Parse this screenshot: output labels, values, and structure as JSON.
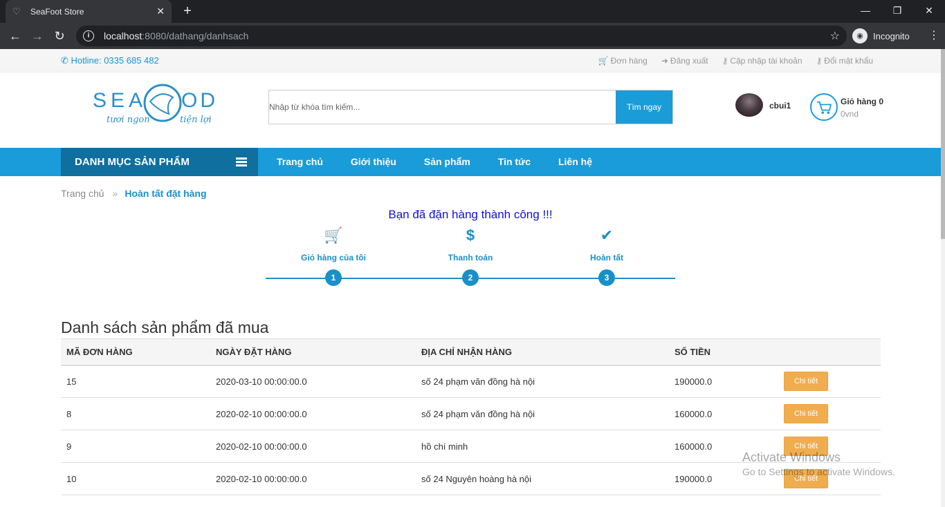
{
  "browser": {
    "tab_title": "SeaFoot Store",
    "tab_close": "✕",
    "new_tab": "+",
    "window_controls": {
      "minimize": "—",
      "restore": "❐",
      "close": "✕"
    },
    "url_host": "localhost",
    "url_rest": ":8080/dathang/danhsach",
    "incognito_label": "Incognito"
  },
  "topbar": {
    "hotline": "Hotline: 0335 685 482",
    "links": [
      {
        "icon": "cart-icon",
        "label": "Đơn hàng"
      },
      {
        "icon": "sign-out-icon",
        "label": "Đăng xuất"
      },
      {
        "icon": "key-icon",
        "label": "Cập nhập tài khoản"
      },
      {
        "icon": "key-icon",
        "label": "Đổi mật khẩu"
      }
    ]
  },
  "header": {
    "logo_text": "SEA FOOD",
    "logo_slogan_left": "tươi ngon",
    "logo_slogan_right": "tiện lợi",
    "search_placeholder": "Nhập từ khóa tìm kiếm...",
    "search_button": "Tìm ngay",
    "username": "cbui1",
    "cart_title": "Giỏ hàng 0",
    "cart_amount": "0vnd"
  },
  "nav": {
    "category_label": "DANH MỤC SẢN PHẨM",
    "items": [
      "Trang chủ",
      "Giới thiệu",
      "Sản phẩm",
      "Tin tức",
      "Liên hệ"
    ]
  },
  "breadcrumb": {
    "home": "Trang chủ",
    "separator": "»",
    "current": "Hoàn tất đặt hàng"
  },
  "success_message": "Bạn đã đặn hàng thành công !!!",
  "steps": [
    {
      "icon": "cart-icon",
      "glyph": "🛒",
      "label": "Giỏ hàng của tôi",
      "number": "1"
    },
    {
      "icon": "dollar-icon",
      "glyph": "$",
      "label": "Thanh toán",
      "number": "2"
    },
    {
      "icon": "check-icon",
      "glyph": "✔",
      "label": "Hoàn tất",
      "number": "3"
    }
  ],
  "orders": {
    "title": "Danh sách sản phẩm đã mua",
    "columns": [
      "MÃ ĐƠN HÀNG",
      "NGÀY ĐẶT HÀNG",
      "ĐỊA CHỈ NHẬN HÀNG",
      "SỐ TIỀN",
      ""
    ],
    "detail_button": "Chi tiết",
    "rows": [
      {
        "id": "15",
        "date": "2020-03-10 00:00:00.0",
        "address": "số 24 phạm văn đồng hà nội",
        "amount": "190000.0"
      },
      {
        "id": "8",
        "date": "2020-02-10 00:00:00.0",
        "address": "số 24 phạm văn đồng hà nội",
        "amount": "160000.0"
      },
      {
        "id": "9",
        "date": "2020-02-10 00:00:00.0",
        "address": "hồ chí minh",
        "amount": "160000.0"
      },
      {
        "id": "10",
        "date": "2020-02-10 00:00:00.0",
        "address": "số 24 Nguyên hoàng hà nội",
        "amount": "190000.0"
      }
    ]
  },
  "watermark": {
    "line1": "Activate Windows",
    "line2": "Go to Settings to activate Windows."
  },
  "colors": {
    "brand": "#1a9cd8",
    "brand_dark": "#0f6f9e",
    "detail_button": "#f0ad4e",
    "success_text": "#1010d0"
  }
}
